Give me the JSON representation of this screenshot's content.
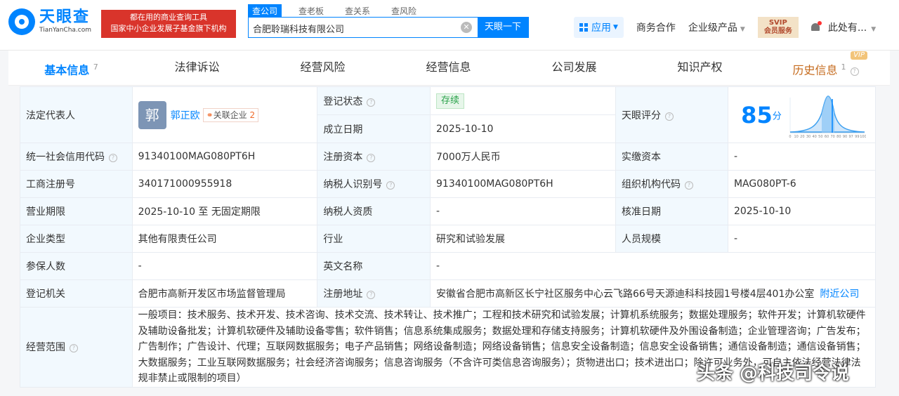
{
  "header": {
    "logo_cn": "天眼查",
    "logo_en": "TianYanCha.com",
    "slogan_line1": "都在用的商业查询工具",
    "slogan_line2": "国家中小企业发展子基金旗下机构",
    "search_tabs": [
      "查公司",
      "查老板",
      "查关系",
      "查风险"
    ],
    "search_value": "合肥聆瑞科技有限公司",
    "search_button": "天眼一下",
    "app_label": "应用",
    "business": "商务合作",
    "enterprise": "企业级产品",
    "vip_line1": "SVIP",
    "vip_line2": "会员服务",
    "user": "此处有..."
  },
  "tabs": [
    {
      "label": "基本信息",
      "count": "7"
    },
    {
      "label": "法律诉讼",
      "count": ""
    },
    {
      "label": "经营风险",
      "count": ""
    },
    {
      "label": "经营信息",
      "count": ""
    },
    {
      "label": "公司发展",
      "count": ""
    },
    {
      "label": "知识产权",
      "count": ""
    },
    {
      "label": "历史信息",
      "count": "1"
    }
  ],
  "vip_tag": "VIP",
  "info": {
    "legal_rep_label": "法定代表人",
    "legal_rep_avatar": "郭",
    "legal_rep_name": "郭正欧",
    "related_label": "关联企业",
    "related_count": "2",
    "reg_status_label": "登记状态",
    "reg_status": "存续",
    "found_date_label": "成立日期",
    "found_date": "2025-10-10",
    "score_label": "天眼评分",
    "score": "85",
    "score_unit": "分",
    "score_ticks": [
      "0",
      "10",
      "20",
      "30",
      "40",
      "50",
      "60",
      "70",
      "80",
      "90",
      "97",
      "99",
      "100"
    ],
    "credit_code_label": "统一社会信用代码",
    "credit_code": "91340100MAG080PT6H",
    "reg_capital_label": "注册资本",
    "reg_capital": "7000万人民币",
    "paid_capital_label": "实缴资本",
    "paid_capital": "-",
    "biz_reg_no_label": "工商注册号",
    "biz_reg_no": "340171000955918",
    "taxpayer_id_label": "纳税人识别号",
    "taxpayer_id": "91340100MAG080PT6H",
    "org_code_label": "组织机构代码",
    "org_code": "MAG080PT-6",
    "term_label": "营业期限",
    "term": "2025-10-10 至 无固定期限",
    "tax_quality_label": "纳税人资质",
    "tax_quality": "-",
    "approve_date_label": "核准日期",
    "approve_date": "2025-10-10",
    "type_label": "企业类型",
    "type": "其他有限责任公司",
    "industry_label": "行业",
    "industry": "研究和试验发展",
    "staff_label": "人员规模",
    "staff": "-",
    "insured_label": "参保人数",
    "insured": "-",
    "en_name_label": "英文名称",
    "en_name": "-",
    "authority_label": "登记机关",
    "authority": "合肥市高新开发区市场监督管理局",
    "address_label": "注册地址",
    "address": "安徽省合肥市高新区长宁社区服务中心云飞路66号天源迪科科技园1号楼4层401办公室",
    "nearby": "附近公司",
    "scope_label": "经营范围",
    "scope": "一般项目：技术服务、技术开发、技术咨询、技术交流、技术转让、技术推广；工程和技术研究和试验发展；计算机系统服务；数据处理服务；软件开发；计算机软硬件及辅助设备批发；计算机软硬件及辅助设备零售；软件销售；信息系统集成服务；数据处理和存储支持服务；计算机软硬件及外围设备制造；企业管理咨询；广告发布；广告制作；广告设计、代理；互联网数据服务；电子产品销售；网络设备制造；网络设备销售；信息安全设备制造；信息安全设备销售；通信设备制造；通信设备销售；大数据服务；工业互联网数据服务；社会经济咨询服务；信息咨询服务（不含许可类信息咨询服务）；货物进出口；技术进出口；除许可业务外，可自主依法经营法律法规非禁止或限制的项目）"
  },
  "watermark": "头条 @科技司令说"
}
